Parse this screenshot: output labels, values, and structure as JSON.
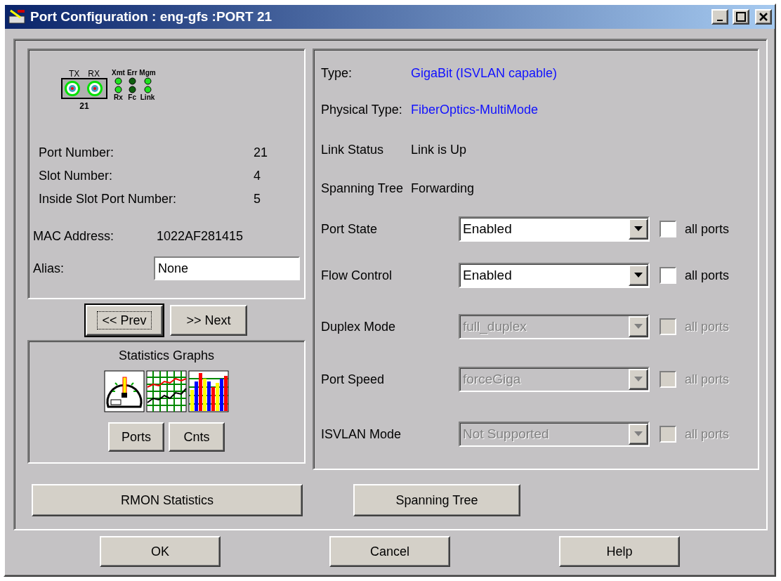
{
  "window": {
    "title": "Port Configuration : eng-gfs :PORT 21"
  },
  "port_panel": {
    "diagram": {
      "connectors": [
        "TX",
        "RX"
      ],
      "port_number": "21",
      "leds": [
        {
          "label": "Xmt",
          "lit": true
        },
        {
          "label": "Err",
          "lit": false
        },
        {
          "label": "Mgm",
          "lit": true
        },
        {
          "label": "Rx",
          "lit": true
        },
        {
          "label": "Fc",
          "lit": false
        },
        {
          "label": "Link",
          "lit": true
        }
      ]
    },
    "info": [
      {
        "label": "Port Number:",
        "value": "21"
      },
      {
        "label": "Slot Number:",
        "value": "4"
      },
      {
        "label": "Inside Slot Port Number:",
        "value": "5"
      }
    ],
    "mac": {
      "label": "MAC Address:",
      "value": "1022AF281415"
    },
    "alias": {
      "label": "Alias:",
      "value": "None"
    }
  },
  "nav_buttons": [
    {
      "label": "<< Prev",
      "focused": true
    },
    {
      "label": ">> Next",
      "focused": false
    }
  ],
  "statistics": {
    "title": "Statistics Graphs",
    "buttons": [
      "Ports",
      "Cnts"
    ]
  },
  "rmon_button": "RMON Statistics",
  "properties": [
    {
      "kind": "text",
      "label": "Type:",
      "value": "GigaBit (ISVLAN capable)",
      "highlight": true
    },
    {
      "kind": "text",
      "label": "Physical Type:",
      "value": "FiberOptics-MultiMode",
      "highlight": true
    },
    {
      "kind": "text",
      "label": "Link Status",
      "value": "Link is Up",
      "highlight": false
    },
    {
      "kind": "text",
      "label": "Spanning Tree",
      "value": "Forwarding",
      "highlight": false
    },
    {
      "kind": "select",
      "label": "Port State",
      "value": "Enabled",
      "disabled": false,
      "checkbox": {
        "label": "all ports",
        "checked": false
      }
    },
    {
      "kind": "select",
      "label": "Flow Control",
      "value": "Enabled",
      "disabled": false,
      "checkbox": {
        "label": "all ports",
        "checked": false
      }
    },
    {
      "kind": "select",
      "label": "Duplex Mode",
      "value": "full_duplex",
      "disabled": true,
      "checkbox": {
        "label": "all ports",
        "checked": false
      }
    },
    {
      "kind": "select",
      "label": "Port Speed",
      "value": "forceGiga",
      "disabled": true,
      "checkbox": {
        "label": "all ports",
        "checked": false
      }
    },
    {
      "kind": "select",
      "label": "ISVLAN Mode",
      "value": "Not Supported",
      "disabled": true,
      "checkbox": {
        "label": "all ports",
        "checked": false
      }
    }
  ],
  "spanning_tree_button": "Spanning Tree",
  "footer_buttons": [
    "OK",
    "Cancel",
    "Help"
  ]
}
